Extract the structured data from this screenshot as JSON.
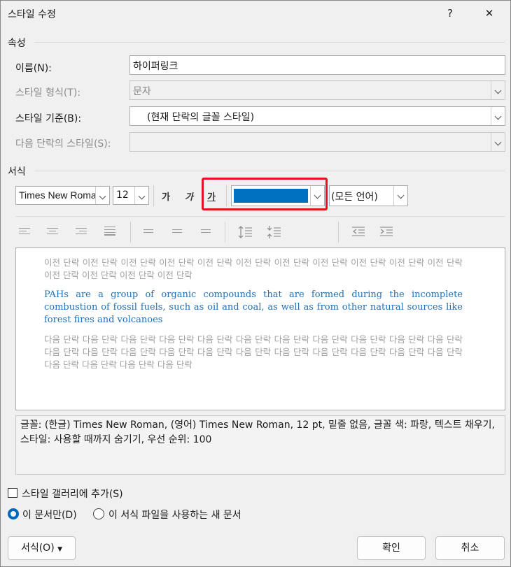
{
  "window": {
    "title": "스타일 수정",
    "help": "?",
    "close": "✕"
  },
  "properties": {
    "section": "속성",
    "name_label": "이름(N):",
    "name_value": "하이퍼링크",
    "type_label": "스타일 형식(T):",
    "type_value": "문자",
    "based_label": "스타일 기준(B):",
    "based_value": "(현재 단락의 글꼴 스타일)",
    "next_label": "다음 단락의 스타일(S):",
    "next_value": ""
  },
  "formatting": {
    "section": "서식",
    "font": "Times New Roman",
    "size": "12",
    "bold": "가",
    "italic": "가",
    "underline": "가",
    "font_color": "#0070c0",
    "language": "(모든 언어)"
  },
  "preview": {
    "prev_text": "이전 단락 이전 단락 이전 단락 이전 단락 이전 단락 이전 단락 이전 단락 이전 단락 이전 단락 이전 단락 이전 단락 이전 단락 이전 단락 이전 단락 이전 단락",
    "sample_text": "PAHs are a group of organic compounds that are formed during the incomplete combustion of fossil fuels, such as oil and coal, as well as from other natural sources like forest fires and volcanoes",
    "next_text": "다음 단락 다음 단락 다음 단락 다음 단락 다음 단락 다음 단락 다음 단락 다음 단락 다음 단락 다음 단락 다음 단락 다음 단락 다음 단락 다음 단락 다음 단락 다음 단락 다음 단락 다음 단락 다음 단락 다음 단락 다음 단락 다음 단락 다음 단락 다음 단락 다음 단락 다음 단락"
  },
  "description": "글꼴: (한글) Times New Roman, (영어) Times New Roman, 12 pt, 밑줄 없음, 글꼴 색: 파랑, 텍스트 채우기, 스타일: 사용할 때까지 숨기기, 우선 순위: 100",
  "options": {
    "add_gallery": "스타일 갤러리에 추가(S)",
    "this_doc": "이 문서만(D)",
    "new_docs": "이 서식 파일을 사용하는 새 문서"
  },
  "buttons": {
    "format": "서식(O)",
    "ok": "확인",
    "cancel": "취소"
  },
  "colors": {
    "highlight": "#e81123",
    "accent": "#0067c0"
  }
}
